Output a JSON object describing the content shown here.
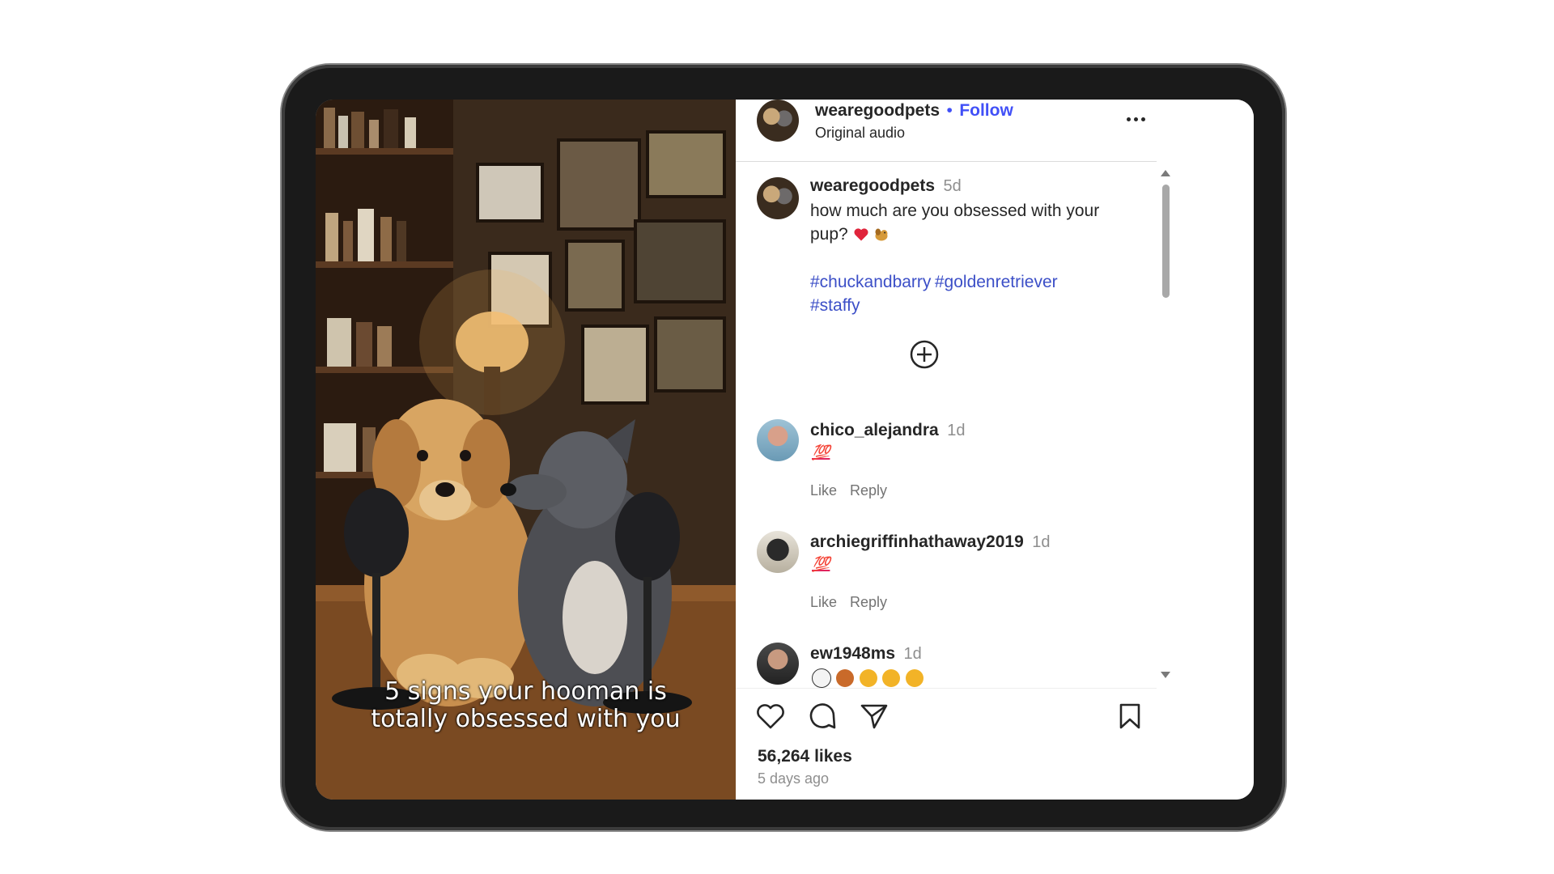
{
  "media": {
    "caption_line1": "5 signs your hooman is",
    "caption_line2": "totally obsessed with you"
  },
  "header": {
    "username": "wearegoodpets",
    "follow_label": "Follow",
    "separator": "•",
    "subtitle": "Original audio",
    "more_icon": "more-horizontal-icon"
  },
  "post": {
    "username": "wearegoodpets",
    "time": "5d",
    "text": "how much are you obsessed with your pup?",
    "hashtags": [
      "#chuckandbarry",
      "#goldenretriever",
      "#staffy"
    ],
    "add_icon": "plus-circle-icon"
  },
  "comments": [
    {
      "username": "chico_alejandra",
      "time": "1d",
      "emoji": "💯",
      "like": "Like",
      "reply": "Reply"
    },
    {
      "username": "archiegriffinhathaway2019",
      "time": "1d",
      "emoji": "💯",
      "like": "Like",
      "reply": "Reply"
    },
    {
      "username": "ew1948ms",
      "time": "1d"
    }
  ],
  "footer": {
    "likes": "56,264 likes",
    "posted": "5 days ago",
    "icons": [
      "heart-icon",
      "comment-icon",
      "share-icon",
      "bookmark-icon"
    ]
  },
  "colors": {
    "link": "#4150f7",
    "hashtag": "#3c4fc7",
    "text": "#262626",
    "muted": "#8e8e8e"
  }
}
